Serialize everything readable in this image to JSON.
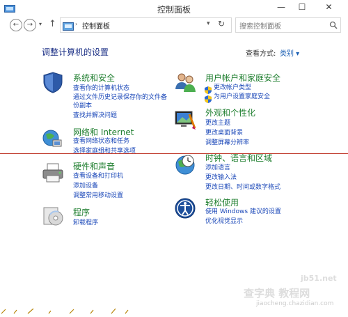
{
  "window": {
    "title": "控制面板",
    "minimize": "—",
    "maximize": "☐",
    "close": "✕"
  },
  "addressbar": {
    "breadcrumb": "控制面板",
    "search_placeholder": "搜索控制面板"
  },
  "content": {
    "heading": "调整计算机的设置",
    "view_by_label": "查看方式:",
    "view_by_value": "类别 ▾",
    "categories": [
      {
        "title": "系统和安全",
        "links": [
          "查看你的计算机状态",
          "通过文件历史记录保存你的文件备",
          "份副本",
          "查找并解决问题"
        ]
      },
      {
        "title": "网络和 Internet",
        "links": [
          "查看网络状态和任务",
          "选择家庭组和共享选项"
        ]
      },
      {
        "title": "硬件和声音",
        "links": [
          "查看设备和打印机",
          "添加设备",
          "调整常用移动设置"
        ]
      },
      {
        "title": "程序",
        "links": [
          "卸载程序"
        ]
      },
      {
        "title": "用户帐户和家庭安全",
        "links": [
          "更改帐户类型",
          "为用户设置家庭安全"
        ]
      },
      {
        "title": "外观和个性化",
        "links": [
          "更改主题",
          "更改桌面背景",
          "调整屏幕分辨率"
        ]
      },
      {
        "title": "时钟、语言和区域",
        "links": [
          "添加语言",
          "更改输入法",
          "更改日期、时间或数字格式"
        ]
      },
      {
        "title": "轻松使用",
        "links": [
          "使用 Windows 建议的设置",
          "优化视觉显示"
        ]
      }
    ]
  },
  "watermark": {
    "main": "查字典 教程网",
    "site": "jb51.net",
    "url": "jiaocheng.chazidian.com"
  },
  "colors": {
    "heading": "#1e3287",
    "category": "#1e7e2e",
    "link": "#1a47b8"
  }
}
